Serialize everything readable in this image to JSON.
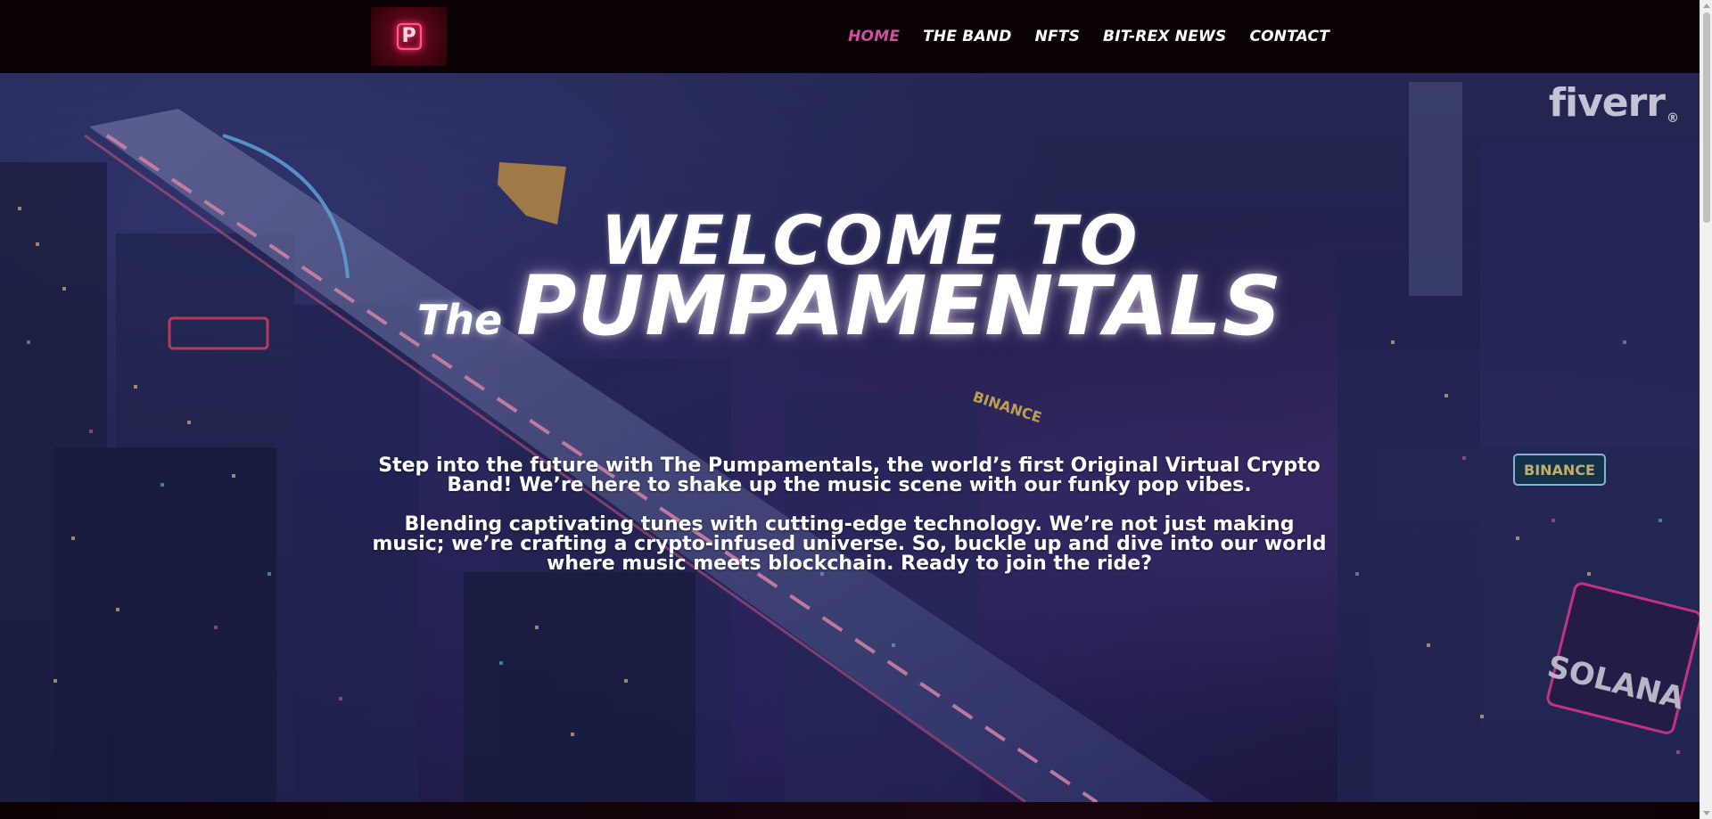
{
  "header": {
    "logo_letter": "P",
    "nav": [
      {
        "label": "HOME",
        "active": true
      },
      {
        "label": "THE BAND",
        "active": false
      },
      {
        "label": "NFTS",
        "active": false
      },
      {
        "label": "BIT-REX NEWS",
        "active": false
      },
      {
        "label": "CONTACT",
        "active": false
      }
    ],
    "active_color": "#d04fa0"
  },
  "hero": {
    "watermark": "fiverr",
    "watermark_mark": "®",
    "welcome": "WELCOME TO",
    "title_prefix": "The",
    "title": "PUMPAMENTALS",
    "paragraph_1": "Step into the future with The Pumpamentals, the world’s first Original Virtual Crypto Band! We’re here to shake up the music scene with our funky pop vibes.",
    "paragraph_2": "Blending captivating tunes with cutting-edge technology. We’re not just making music; we’re crafting a crypto-infused universe. So, buckle up and dive into our world where music meets blockchain. Ready to join the ride?",
    "signs": [
      "BINANCE",
      "BINANCE",
      "SOLANA"
    ]
  }
}
